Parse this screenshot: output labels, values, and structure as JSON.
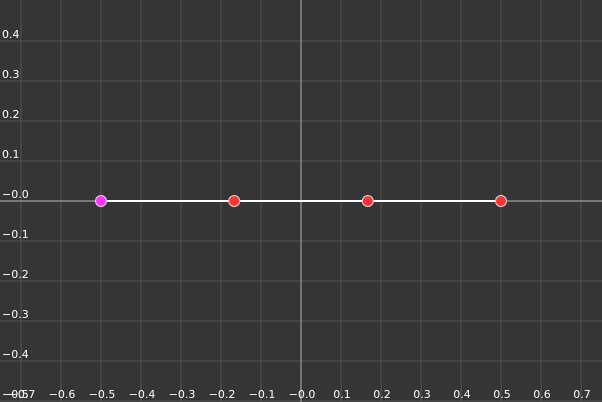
{
  "chart_data": {
    "type": "line",
    "title": "",
    "xlabel": "",
    "ylabel": "",
    "grid": true,
    "xlim": [
      -0.75,
      0.75
    ],
    "ylim": [
      -0.5,
      0.5
    ],
    "x_ticks": [
      {
        "value": -0.7,
        "label": "−0.7"
      },
      {
        "value": -0.6,
        "label": "−0.6"
      },
      {
        "value": -0.5,
        "label": "−0.5"
      },
      {
        "value": -0.4,
        "label": "−0.4"
      },
      {
        "value": -0.3,
        "label": "−0.3"
      },
      {
        "value": -0.2,
        "label": "−0.2"
      },
      {
        "value": -0.1,
        "label": "−0.1"
      },
      {
        "value": 0.0,
        "label": "−0.0"
      },
      {
        "value": 0.1,
        "label": "0.1"
      },
      {
        "value": 0.2,
        "label": "0.2"
      },
      {
        "value": 0.3,
        "label": "0.3"
      },
      {
        "value": 0.4,
        "label": "0.4"
      },
      {
        "value": 0.5,
        "label": "0.5"
      },
      {
        "value": 0.6,
        "label": "0.6"
      },
      {
        "value": 0.7,
        "label": "0.7"
      }
    ],
    "y_ticks": [
      {
        "value": 0.4,
        "label": "0.4"
      },
      {
        "value": 0.3,
        "label": "0.3"
      },
      {
        "value": 0.2,
        "label": "0.2"
      },
      {
        "value": 0.1,
        "label": "0.1"
      },
      {
        "value": 0.0,
        "label": "−0.0"
      },
      {
        "value": -0.1,
        "label": "−0.1"
      },
      {
        "value": -0.2,
        "label": "−0.2"
      },
      {
        "value": -0.3,
        "label": "−0.3"
      },
      {
        "value": -0.4,
        "label": "−0.4"
      },
      {
        "value": -0.5,
        "label": "−0.5"
      }
    ],
    "series": [
      {
        "line_color": "#ffffff",
        "points": [
          {
            "x": -0.5,
            "y": 0.0,
            "color": "#ff33ff"
          },
          {
            "x": -0.167,
            "y": 0.0,
            "color": "#ff3333"
          },
          {
            "x": 0.167,
            "y": 0.0,
            "color": "#ff3333"
          },
          {
            "x": 0.5,
            "y": 0.0,
            "color": "#ff3333"
          }
        ]
      }
    ]
  },
  "colors": {
    "background": "#353535",
    "grid": "#555555",
    "axis": "#8f8f8f",
    "text": "#ffffff"
  }
}
